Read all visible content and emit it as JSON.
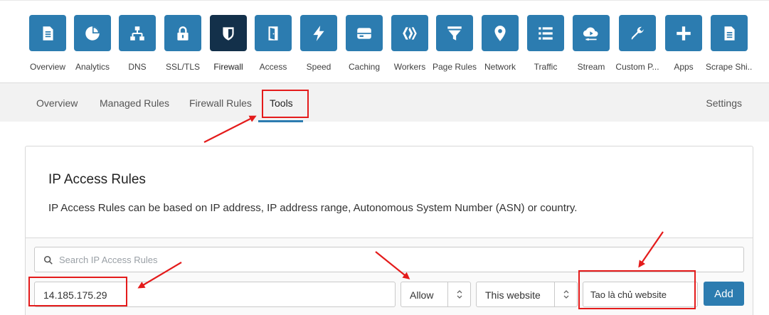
{
  "top_nav": {
    "items": [
      {
        "label": "Overview",
        "icon": "document-icon",
        "active": false
      },
      {
        "label": "Analytics",
        "icon": "pie-chart-icon",
        "active": false
      },
      {
        "label": "DNS",
        "icon": "network-tree-icon",
        "active": false
      },
      {
        "label": "SSL/TLS",
        "icon": "lock-icon",
        "active": false
      },
      {
        "label": "Firewall",
        "icon": "shield-icon",
        "active": true
      },
      {
        "label": "Access",
        "icon": "door-icon",
        "active": false
      },
      {
        "label": "Speed",
        "icon": "lightning-icon",
        "active": false
      },
      {
        "label": "Caching",
        "icon": "server-icon",
        "active": false
      },
      {
        "label": "Workers",
        "icon": "workers-icon",
        "active": false
      },
      {
        "label": "Page Rules",
        "icon": "filter-icon",
        "active": false
      },
      {
        "label": "Network",
        "icon": "location-pin-icon",
        "active": false
      },
      {
        "label": "Traffic",
        "icon": "list-icon",
        "active": false
      },
      {
        "label": "Stream",
        "icon": "cloud-play-icon",
        "active": false
      },
      {
        "label": "Custom P...",
        "icon": "wrench-icon",
        "active": false
      },
      {
        "label": "Apps",
        "icon": "plus-icon",
        "active": false
      },
      {
        "label": "Scrape Shi...",
        "icon": "page-icon",
        "active": false
      }
    ]
  },
  "sub_nav": {
    "tabs": [
      "Overview",
      "Managed Rules",
      "Firewall Rules",
      "Tools"
    ],
    "active_tab": "Tools",
    "settings_label": "Settings"
  },
  "card": {
    "title": "IP Access Rules",
    "description": "IP Access Rules can be based on IP address, IP address range, Autonomous System Number (ASN) or country."
  },
  "form": {
    "search_placeholder": "Search IP Access Rules",
    "ip_value": "14.185.175.29",
    "action_value": "Allow",
    "scope_value": "This website",
    "note_value": "Tao là chủ website",
    "add_label": "Add"
  },
  "colors": {
    "accent": "#2c7cb0",
    "active_tile": "#13304a",
    "annotation": "#e41b1b"
  }
}
